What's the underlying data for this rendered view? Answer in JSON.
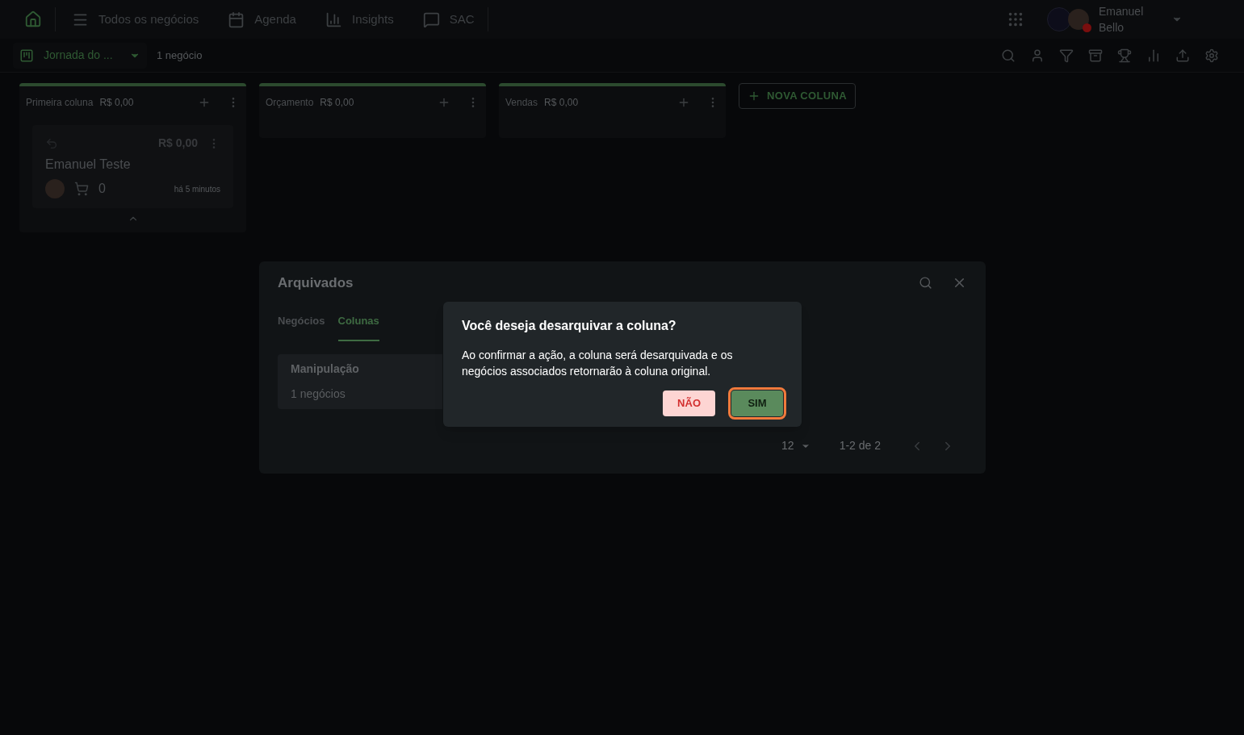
{
  "nav": {
    "items": [
      {
        "label": "Todos os negócios"
      },
      {
        "label": "Agenda"
      },
      {
        "label": "Insights"
      },
      {
        "label": "SAC"
      }
    ],
    "user": {
      "first_name": "Emanuel",
      "last_name": "Bello",
      "online": false
    }
  },
  "toolbar": {
    "board": "Jornada do ...",
    "count": "1 negócio"
  },
  "columns": [
    {
      "name": "Primeira coluna",
      "total": "R$ 0,00",
      "cards": [
        {
          "value": "R$ 0,00",
          "title": "Emanuel Teste",
          "count": "0",
          "time": "há 5 minutos"
        }
      ]
    },
    {
      "name": "Orçamento",
      "total": "R$ 0,00"
    },
    {
      "name": "Vendas",
      "total": "R$ 0,00"
    }
  ],
  "new_column_button": "NOVA COLUNA",
  "archived": {
    "title": "Arquivados",
    "tabs": [
      {
        "label": "Negócios",
        "selected": false
      },
      {
        "label": "Colunas",
        "selected": true
      }
    ],
    "items": [
      {
        "name": "Manipulação",
        "count": "1 negócios"
      }
    ],
    "pagination": {
      "per_page": "12",
      "range": "1-2 de 2"
    }
  },
  "confirm": {
    "title": "Você deseja desarquivar a coluna?",
    "message": "Ao confirmar a ação, a coluna será desarquivada e os negócios associados retornarão à coluna original.",
    "buttons": [
      {
        "label": "NÃO",
        "kind": "cancel",
        "focused": false
      },
      {
        "label": "SIM",
        "kind": "confirm",
        "focused": true
      }
    ]
  }
}
